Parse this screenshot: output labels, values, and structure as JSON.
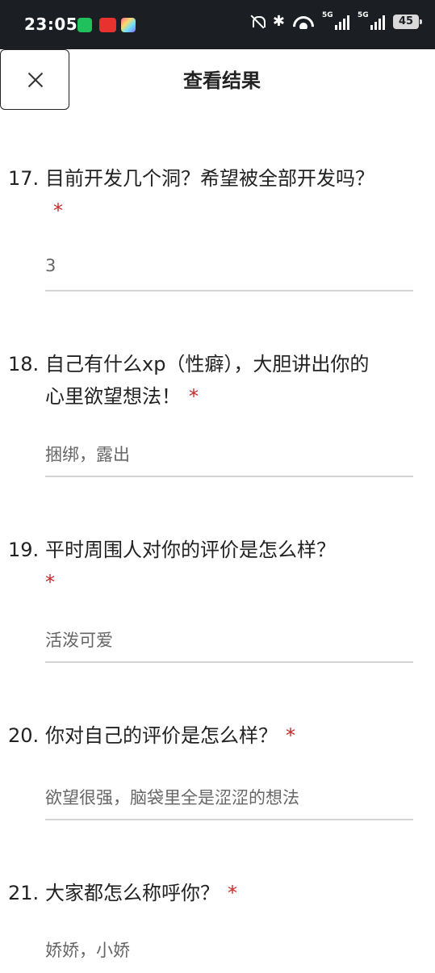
{
  "status_bar": {
    "time": "23:05",
    "battery": "45",
    "signal1_label": "5G",
    "signal2_label": "5G",
    "icons": [
      "wechat-app-icon",
      "xiaohongshu-app-icon",
      "photo-app-icon",
      "mute-icon",
      "bluetooth-icon",
      "wifi-icon",
      "signal-icon",
      "signal-icon",
      "battery-icon"
    ]
  },
  "header": {
    "title": "查看结果",
    "close_icon": "close-icon"
  },
  "questions": [
    {
      "number": "17.",
      "text": "目前开发几个洞？希望被全部开发吗？",
      "required": "*",
      "answer": "3"
    },
    {
      "number": "18.",
      "text": "自己有什么xp（性癖），大胆讲出你的心里欲望想法！",
      "required": "*",
      "answer": "捆绑，露出"
    },
    {
      "number": "19.",
      "text": "平时周围人对你的评价是怎么样？",
      "required": "*",
      "answer": "活泼可爱"
    },
    {
      "number": "20.",
      "text": "你对自己的评价是怎么样？",
      "required": "*",
      "answer": "欲望很强，脑袋里全是涩涩的想法"
    },
    {
      "number": "21.",
      "text": "大家都怎么称呼你？",
      "required": "*",
      "answer": "娇娇，小娇"
    }
  ]
}
